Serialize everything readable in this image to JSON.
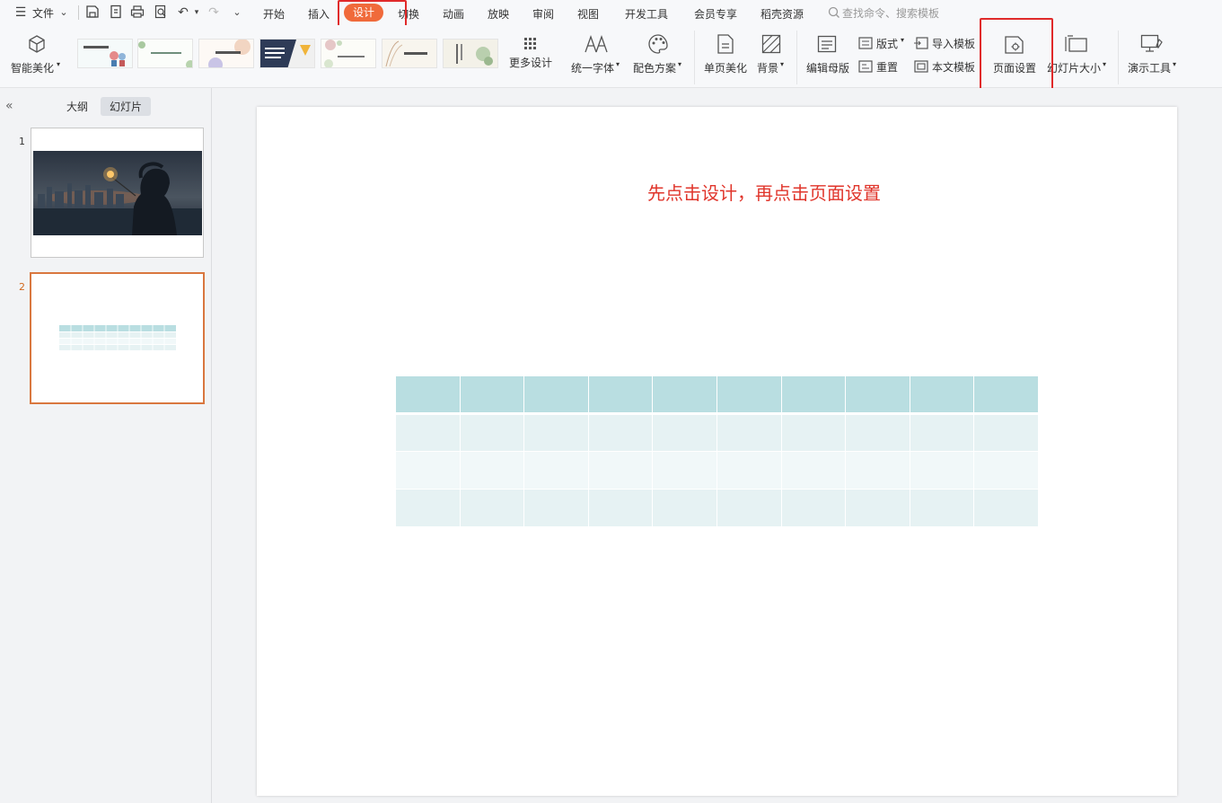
{
  "menubar": {
    "file_label": "文件",
    "tabs": [
      "开始",
      "插入",
      "设计",
      "切换",
      "动画",
      "放映",
      "审阅",
      "视图",
      "开发工具",
      "会员专享",
      "稻壳资源"
    ],
    "active_tab": "设计",
    "search_placeholder": "查找命令、搜索模板"
  },
  "ribbon": {
    "smart_beautify": "智能美化",
    "more_design": "更多设计",
    "unify_font": "统一字体",
    "color_scheme": "配色方案",
    "page_beautify": "单页美化",
    "background": "背景",
    "edit_master": "编辑母版",
    "layout": "版式",
    "reset": "重置",
    "import_template": "导入模板",
    "text_template": "本文模板",
    "page_setup": "页面设置",
    "slide_size": "幻灯片大小",
    "present_tools": "演示工具",
    "accent_color": "#f06a3b",
    "highlight_color": "#e02a2a"
  },
  "left_panel": {
    "tab_outline": "大纲",
    "tab_slides": "幻灯片",
    "slides": [
      {
        "number": "1"
      },
      {
        "number": "2"
      }
    ],
    "selected_slide": "2"
  },
  "slide": {
    "title": "先点击设计，再点击页面设置",
    "table": {
      "columns": 10,
      "rows": 4,
      "header_color": "#b9dee1",
      "row_colors": [
        "#e6f2f3",
        "#f1f8f9",
        "#e6f2f3"
      ]
    }
  }
}
